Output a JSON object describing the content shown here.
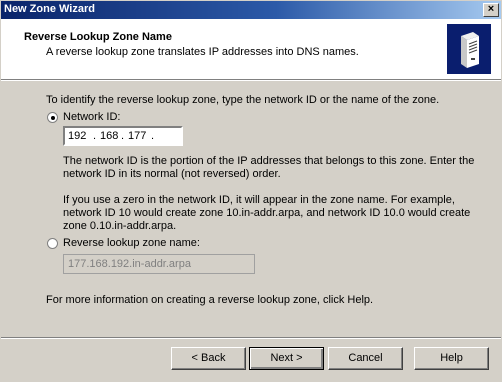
{
  "window": {
    "title": "New Zone Wizard",
    "close_glyph": "×"
  },
  "header": {
    "title": "Reverse Lookup Zone Name",
    "subtitle": "A reverse lookup zone translates IP addresses into DNS names.",
    "icon": "server-icon"
  },
  "body": {
    "intro": "To identify the reverse lookup zone, type the network ID or the name of the zone.",
    "network_id": {
      "label": "Network ID:",
      "selected": true,
      "segments": [
        "192",
        "168",
        "177",
        ""
      ],
      "desc1_line1": "The network ID is the portion of the IP addresses that belongs to this zone. Enter the",
      "desc1_line2": "network ID in its normal (not reversed) order.",
      "desc2_line1": "If you use a zero in the network ID, it will appear in the zone name. For example,",
      "desc2_line2": "network ID 10 would create zone 10.in-addr.arpa, and network ID 10.0 would create",
      "desc2_line3": "zone 0.10.in-addr.arpa."
    },
    "reverse_zone": {
      "label": "Reverse lookup zone name:",
      "selected": false,
      "value": "177.168.192.in-addr.arpa"
    },
    "help_text": "For more information on creating a reverse lookup zone, click Help."
  },
  "buttons": {
    "back": "< Back",
    "next": "Next >",
    "cancel": "Cancel",
    "help": "Help"
  }
}
